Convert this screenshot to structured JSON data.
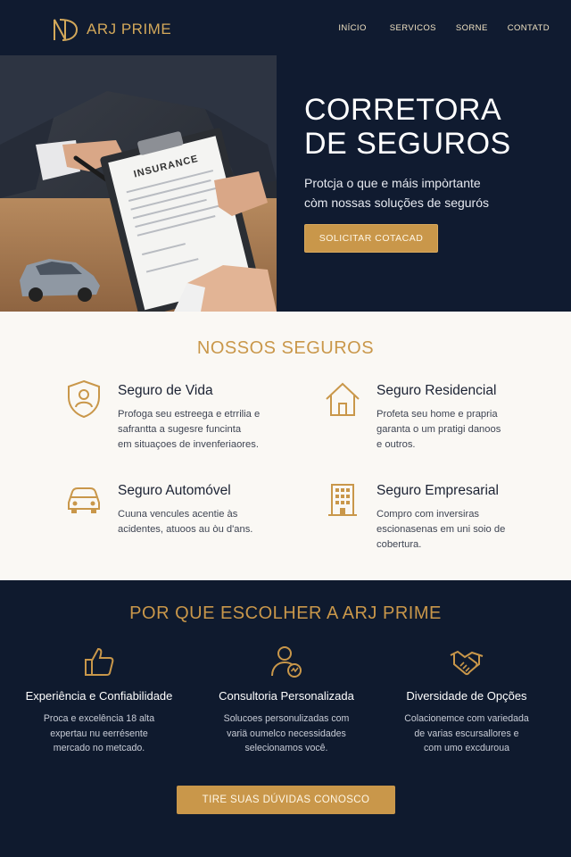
{
  "brand": {
    "name": "ARJ PRIME"
  },
  "nav": [
    "INÍCIO",
    "SERVICOS",
    "SORNE",
    "CONTATD"
  ],
  "hero": {
    "title": "CORRETORA\nDE SEGUROS",
    "subtitle": "Protcja o que e máis impòrtante\ncòm nossas soluções de segurós",
    "cta": "SOLICITAR COTACAD",
    "photo_text": "INSURANCE"
  },
  "services": {
    "title": "NOSSOS SEGUROS",
    "items": [
      {
        "name": "Seguro de Vida",
        "desc": "Profoga seu estreega e etrrilia e\nsafrantta a sugesre funcinta\nem situaçoes de invenferiaores.",
        "icon": "shield-person-icon"
      },
      {
        "name": "Seguro Residencial",
        "desc": "Profeta seu home e prapria\ngaranta o um pratigi danoos\ne outros.",
        "icon": "house-icon"
      },
      {
        "name": "Seguro Automóvel",
        "desc": "Cuuna vencules acentie às\nacidentes, atuoos au òu d'ans.",
        "icon": "car-icon"
      },
      {
        "name": "Seguro Empresarial",
        "desc": "Compro com inversiras\nescionasenas em uni soio de\ncobertura.",
        "icon": "building-icon"
      }
    ]
  },
  "why": {
    "title": "POR QUE ESCOLHER A ARJ PRIME",
    "features": [
      {
        "name": "Experiência e Confiabilidade",
        "desc": "Proca e excelência 18 alta\nexpertau nu eerrésente\nmercado no metcado.",
        "icon": "thumbs-up-icon"
      },
      {
        "name": "Consultoria Personalizada",
        "desc": "Solucoes personulizadas com\nvariä oumelco necessidades\nselecionamos você.",
        "icon": "consultant-icon"
      },
      {
        "name": "Diversidade de Opções",
        "desc": "Colacionemce com variedada\nde varias escursallores e\ncom umo excduroua",
        "icon": "handshake-icon"
      }
    ],
    "cta": "TIRE SUAS DÚVIDAS CONOSCO"
  },
  "colors": {
    "navy": "#0f1a2e",
    "gold": "#c9974a",
    "cream": "#faf8f4"
  }
}
